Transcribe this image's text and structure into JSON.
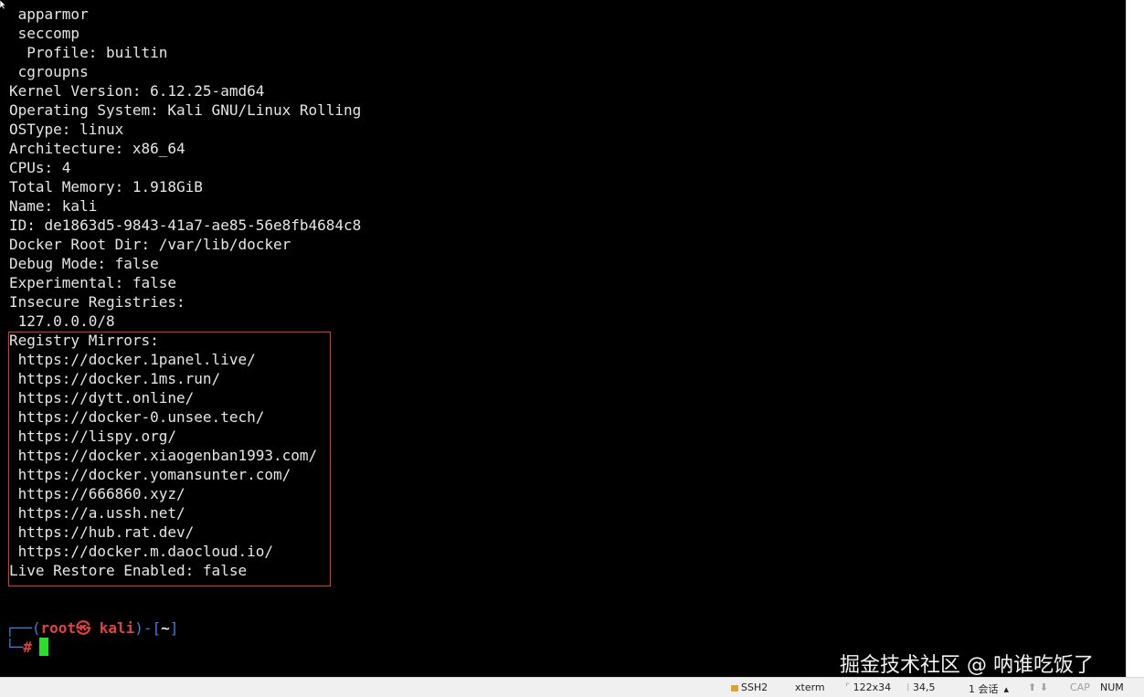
{
  "terminal": {
    "lines": [
      " apparmor",
      " seccomp",
      "  Profile: builtin",
      " cgroupns",
      "Kernel Version: 6.12.25-amd64",
      "Operating System: Kali GNU/Linux Rolling",
      "OSType: linux",
      "Architecture: x86_64",
      "CPUs: 4",
      "Total Memory: 1.918GiB",
      "Name: kali",
      "ID: de1863d5-9843-41a7-ae85-56e8fb4684c8",
      "Docker Root Dir: /var/lib/docker",
      "Debug Mode: false",
      "Experimental: false",
      "Insecure Registries:",
      " 127.0.0.0/8",
      "Registry Mirrors:",
      " https://docker.1panel.live/",
      " https://docker.1ms.run/",
      " https://dytt.online/",
      " https://docker-0.unsee.tech/",
      " https://lispy.org/",
      " https://docker.xiaogenban1993.com/",
      " https://docker.yomansunter.com/",
      " https://666860.xyz/",
      " https://a.ussh.net/",
      " https://hub.rat.dev/",
      " https://docker.m.daocloud.io/",
      "Live Restore Enabled: false"
    ],
    "prompt": {
      "open": "┌──(",
      "user": "root㉿",
      "host": " kali",
      "close": ")-[",
      "cwd": "~",
      "end": "]",
      "line2_corner": "└─",
      "symbol": "#"
    }
  },
  "watermark": "掘金技术社区 @ 呐谁吃饭了",
  "statusbar": {
    "protocol": "SSH2",
    "terminal_type": "xterm",
    "size": "122x34",
    "position": "34,5",
    "sessions": "1 会话",
    "cap": "CAP",
    "num": "NUM"
  },
  "colors": {
    "highlight_box": "#d43a2f",
    "prompt_blue": "#3d7fd9",
    "prompt_red": "#e0443c",
    "cursor_green": "#28e028"
  }
}
